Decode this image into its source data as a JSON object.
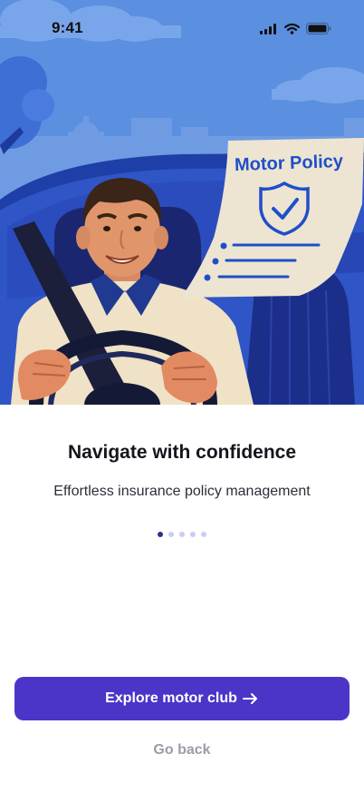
{
  "status_bar": {
    "time": "9:41",
    "icons": [
      "cellular-signal-icon",
      "wifi-icon",
      "battery-icon"
    ]
  },
  "hero": {
    "policy_title": "Motor Policy",
    "shield_icon": "shield-check-icon"
  },
  "onboarding": {
    "title": "Navigate with confidence",
    "subtitle": "Effortless insurance policy management",
    "page_count": 5,
    "active_page": 1
  },
  "actions": {
    "primary_label": "Explore motor club",
    "primary_icon": "arrow-right-icon",
    "secondary_label": "Go back"
  },
  "colors": {
    "accent": "#4b35c8",
    "hero_sky": "#5b8fe0",
    "policy_blue": "#1f4fc8",
    "dot_active": "#2b2f8f",
    "dot_inactive": "#c9cdf3",
    "secondary_text": "#9a9dab"
  }
}
